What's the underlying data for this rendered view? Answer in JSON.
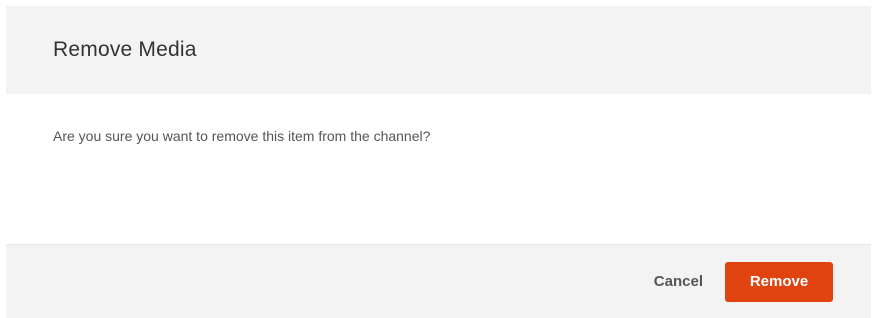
{
  "dialog": {
    "title": "Remove Media",
    "message": "Are you sure you want to remove this item from the channel?",
    "cancel_label": "Cancel",
    "confirm_label": "Remove"
  },
  "colors": {
    "header_bg": "#f3f3f3",
    "footer_bg": "#f3f3f3",
    "confirm_button_bg": "#e0430f",
    "confirm_button_text": "#ffffff",
    "title_text": "#333333",
    "body_text": "#555555"
  }
}
